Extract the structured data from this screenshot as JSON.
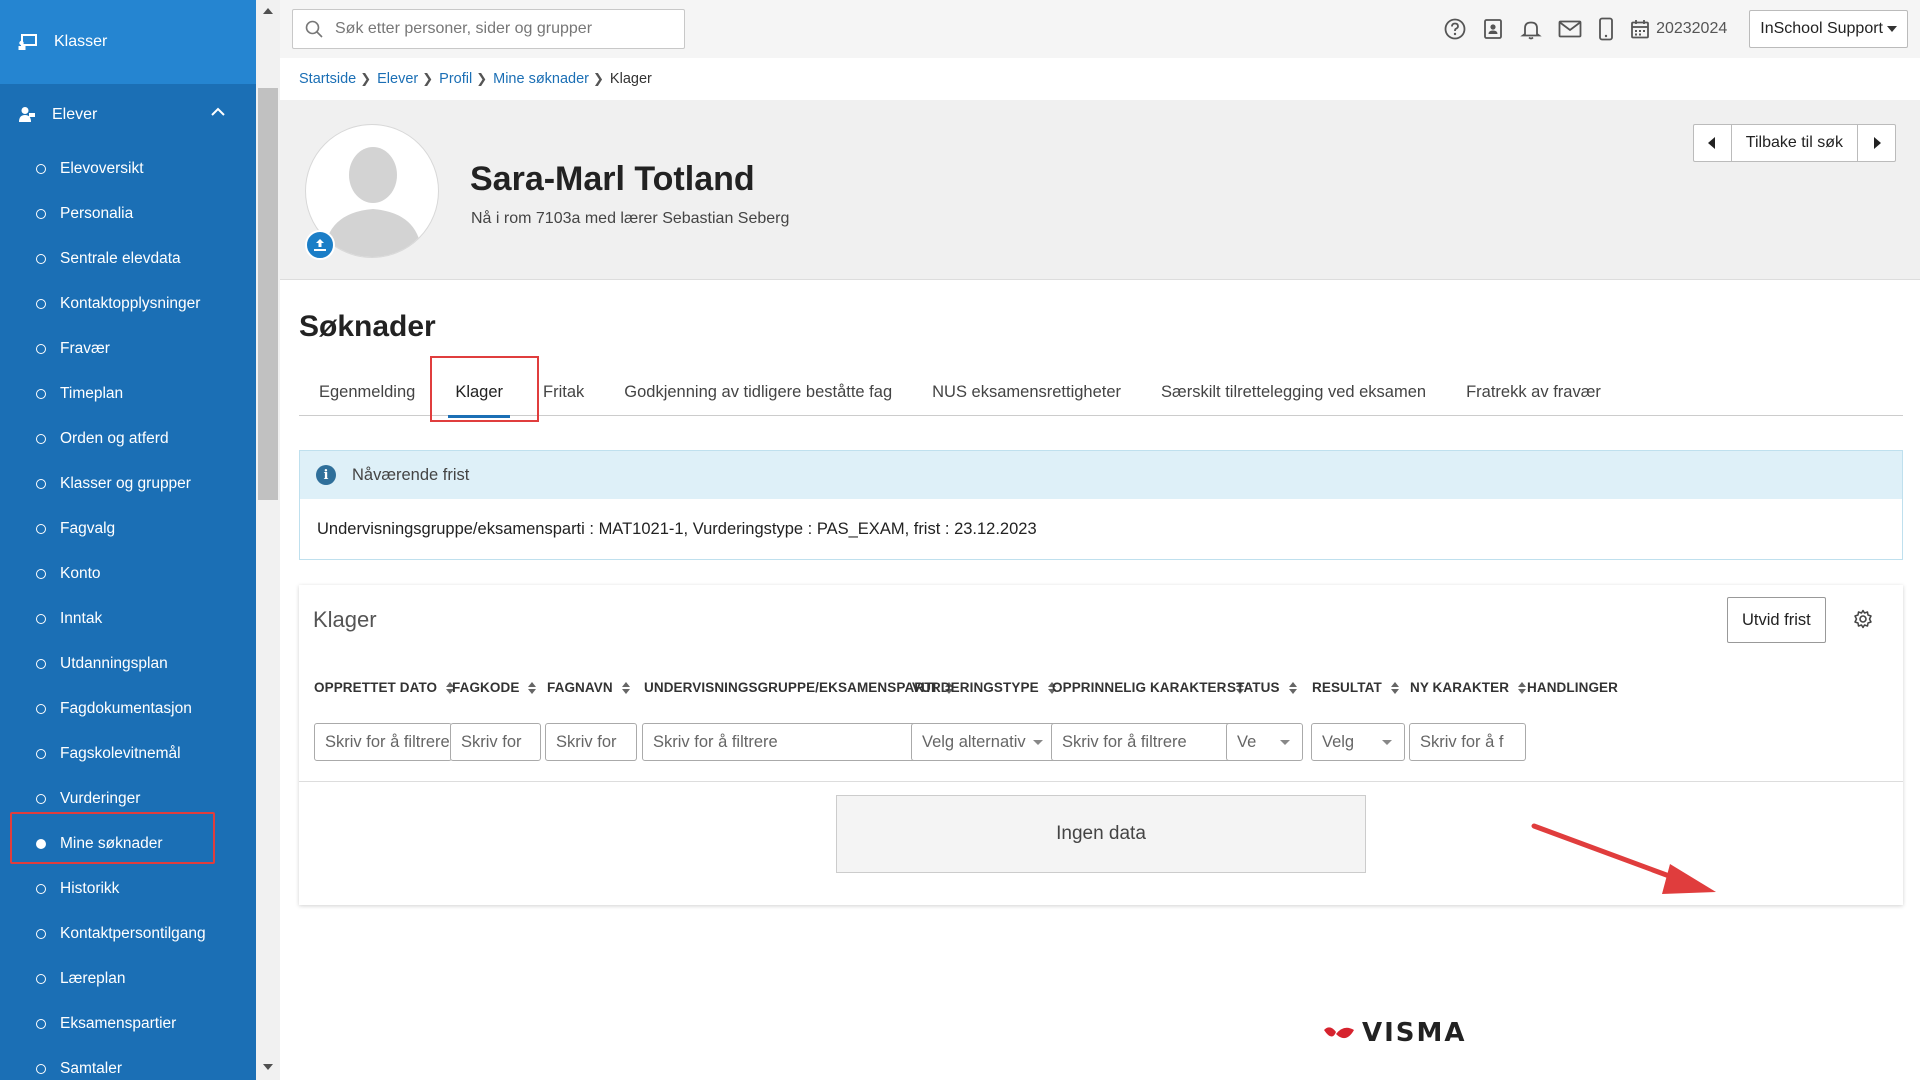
{
  "sidebar": {
    "top_label": "Klasser",
    "section_label": "Elever",
    "items": [
      {
        "label": "Elevoversikt"
      },
      {
        "label": "Personalia"
      },
      {
        "label": "Sentrale elevdata"
      },
      {
        "label": "Kontaktopplysninger"
      },
      {
        "label": "Fravær"
      },
      {
        "label": "Timeplan"
      },
      {
        "label": "Orden og atferd"
      },
      {
        "label": "Klasser og grupper"
      },
      {
        "label": "Fagvalg"
      },
      {
        "label": "Konto"
      },
      {
        "label": "Inntak"
      },
      {
        "label": "Utdanningsplan"
      },
      {
        "label": "Fagdokumentasjon"
      },
      {
        "label": "Fagskolevitnemål"
      },
      {
        "label": "Vurderinger"
      },
      {
        "label": "Mine søknader"
      },
      {
        "label": "Historikk"
      },
      {
        "label": "Kontaktpersontilgang"
      },
      {
        "label": "Læreplan"
      },
      {
        "label": "Eksamenspartier"
      },
      {
        "label": "Samtaler"
      }
    ],
    "active_item": "Mine søknader"
  },
  "topbar": {
    "search_placeholder": "Søk etter personer, sider og grupper",
    "year": "20232024",
    "user": "InSchool Support"
  },
  "breadcrumb": {
    "items": [
      "Startside",
      "Elever",
      "Profil",
      "Mine søknader"
    ],
    "current": "Klager"
  },
  "profile": {
    "name": "Sara-Marl Totland",
    "location": "Nå i rom 7103a med lærer Sebastian Seberg",
    "back_label": "Tilbake til søk"
  },
  "page": {
    "title": "Søknader",
    "tabs": [
      {
        "label": "Egenmelding"
      },
      {
        "label": "Klager"
      },
      {
        "label": "Fritak"
      },
      {
        "label": "Godkjenning av tidligere beståtte fag"
      },
      {
        "label": "NUS eksamensrettigheter"
      },
      {
        "label": "Særskilt tilrettelegging ved eksamen"
      },
      {
        "label": "Fratrekk av fravær"
      }
    ],
    "active_tab": "Klager"
  },
  "info": {
    "heading": "Nåværende frist",
    "text": "Undervisningsgruppe/eksamensparti : MAT1021-1, Vurderingstype : PAS_EXAM, frist : 23.12.2023"
  },
  "panel": {
    "title": "Klager",
    "extend_button": "Utvid frist",
    "columns": [
      {
        "header": "OPPRETTET DATO",
        "filter": "Skriv for å filtrere",
        "kind": "text"
      },
      {
        "header": "FAGKODE",
        "filter": "Skriv for",
        "kind": "text"
      },
      {
        "header": "FAGNAVN",
        "filter": "Skriv for",
        "kind": "text"
      },
      {
        "header": "UNDERVISNINGSGRUPPE/EKSAMENSPARTI",
        "filter": "Skriv for å filtrere",
        "kind": "text"
      },
      {
        "header": "VURDERINGSTYPE",
        "filter": "Velg alternativ",
        "kind": "select"
      },
      {
        "header": "OPPRINNELIG KARAKTER",
        "filter": "Skriv for å filtrere",
        "kind": "text"
      },
      {
        "header": "STATUS",
        "filter": "Ve",
        "kind": "select"
      },
      {
        "header": "RESULTAT",
        "filter": "Velg",
        "kind": "select"
      },
      {
        "header": "NY KARAKTER",
        "filter": "Skriv for å f",
        "kind": "text"
      },
      {
        "header": "HANDLINGER"
      }
    ],
    "empty_text": "Ingen data"
  },
  "footer": {
    "brand": "VISMA"
  },
  "colors": {
    "sidebar_bg": "#1b6fb5",
    "sidebar_top_bg": "#2585d1",
    "accent": "#1b6fb5",
    "highlight": "#e03d3d",
    "info_bg": "#def0f8"
  }
}
